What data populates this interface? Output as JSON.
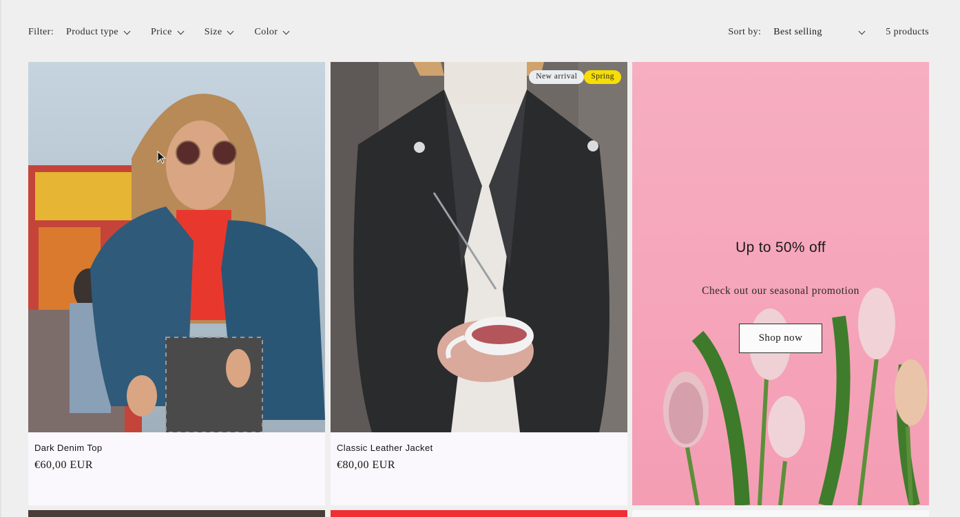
{
  "filter": {
    "label": "Filter:",
    "options": [
      "Product type",
      "Price",
      "Size",
      "Color"
    ]
  },
  "sort": {
    "label": "Sort by:",
    "selected": "Best selling"
  },
  "product_count": "5 products",
  "products": [
    {
      "title": "Dark Denim Top",
      "price": "€60,00 EUR",
      "badges": []
    },
    {
      "title": "Classic Leather Jacket",
      "price": "€80,00 EUR",
      "badges": [
        "New arrival",
        "Spring"
      ]
    }
  ],
  "promo": {
    "title": "Up to 50% off",
    "subtitle": "Check out our seasonal promotion",
    "button_label": "Shop now"
  },
  "colors": {
    "background": "#efefef",
    "card": "#faf8fc",
    "promo_pink": "#f6a9bd",
    "badge_new": "#e9edf0",
    "badge_spring": "#f6dd06"
  }
}
